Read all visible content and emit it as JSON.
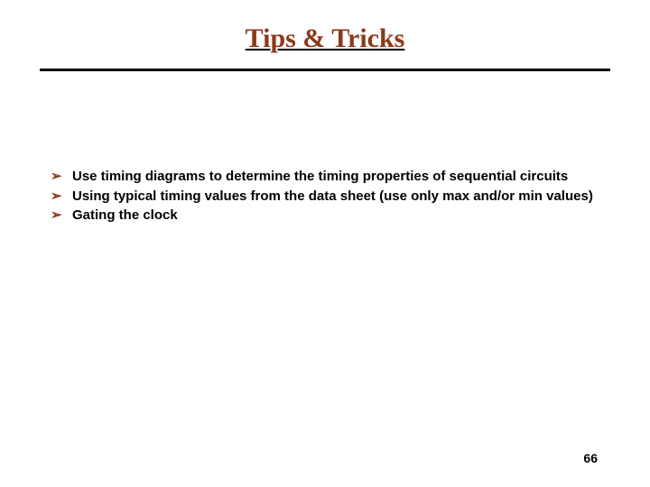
{
  "title": "Tips & Tricks",
  "bullets": [
    "Use timing diagrams to determine the timing properties of sequential circuits",
    "Using typical timing values from the data sheet (use only max and/or min values)",
    "Gating the clock"
  ],
  "bullet_glyph": "➢",
  "page_number": "66"
}
